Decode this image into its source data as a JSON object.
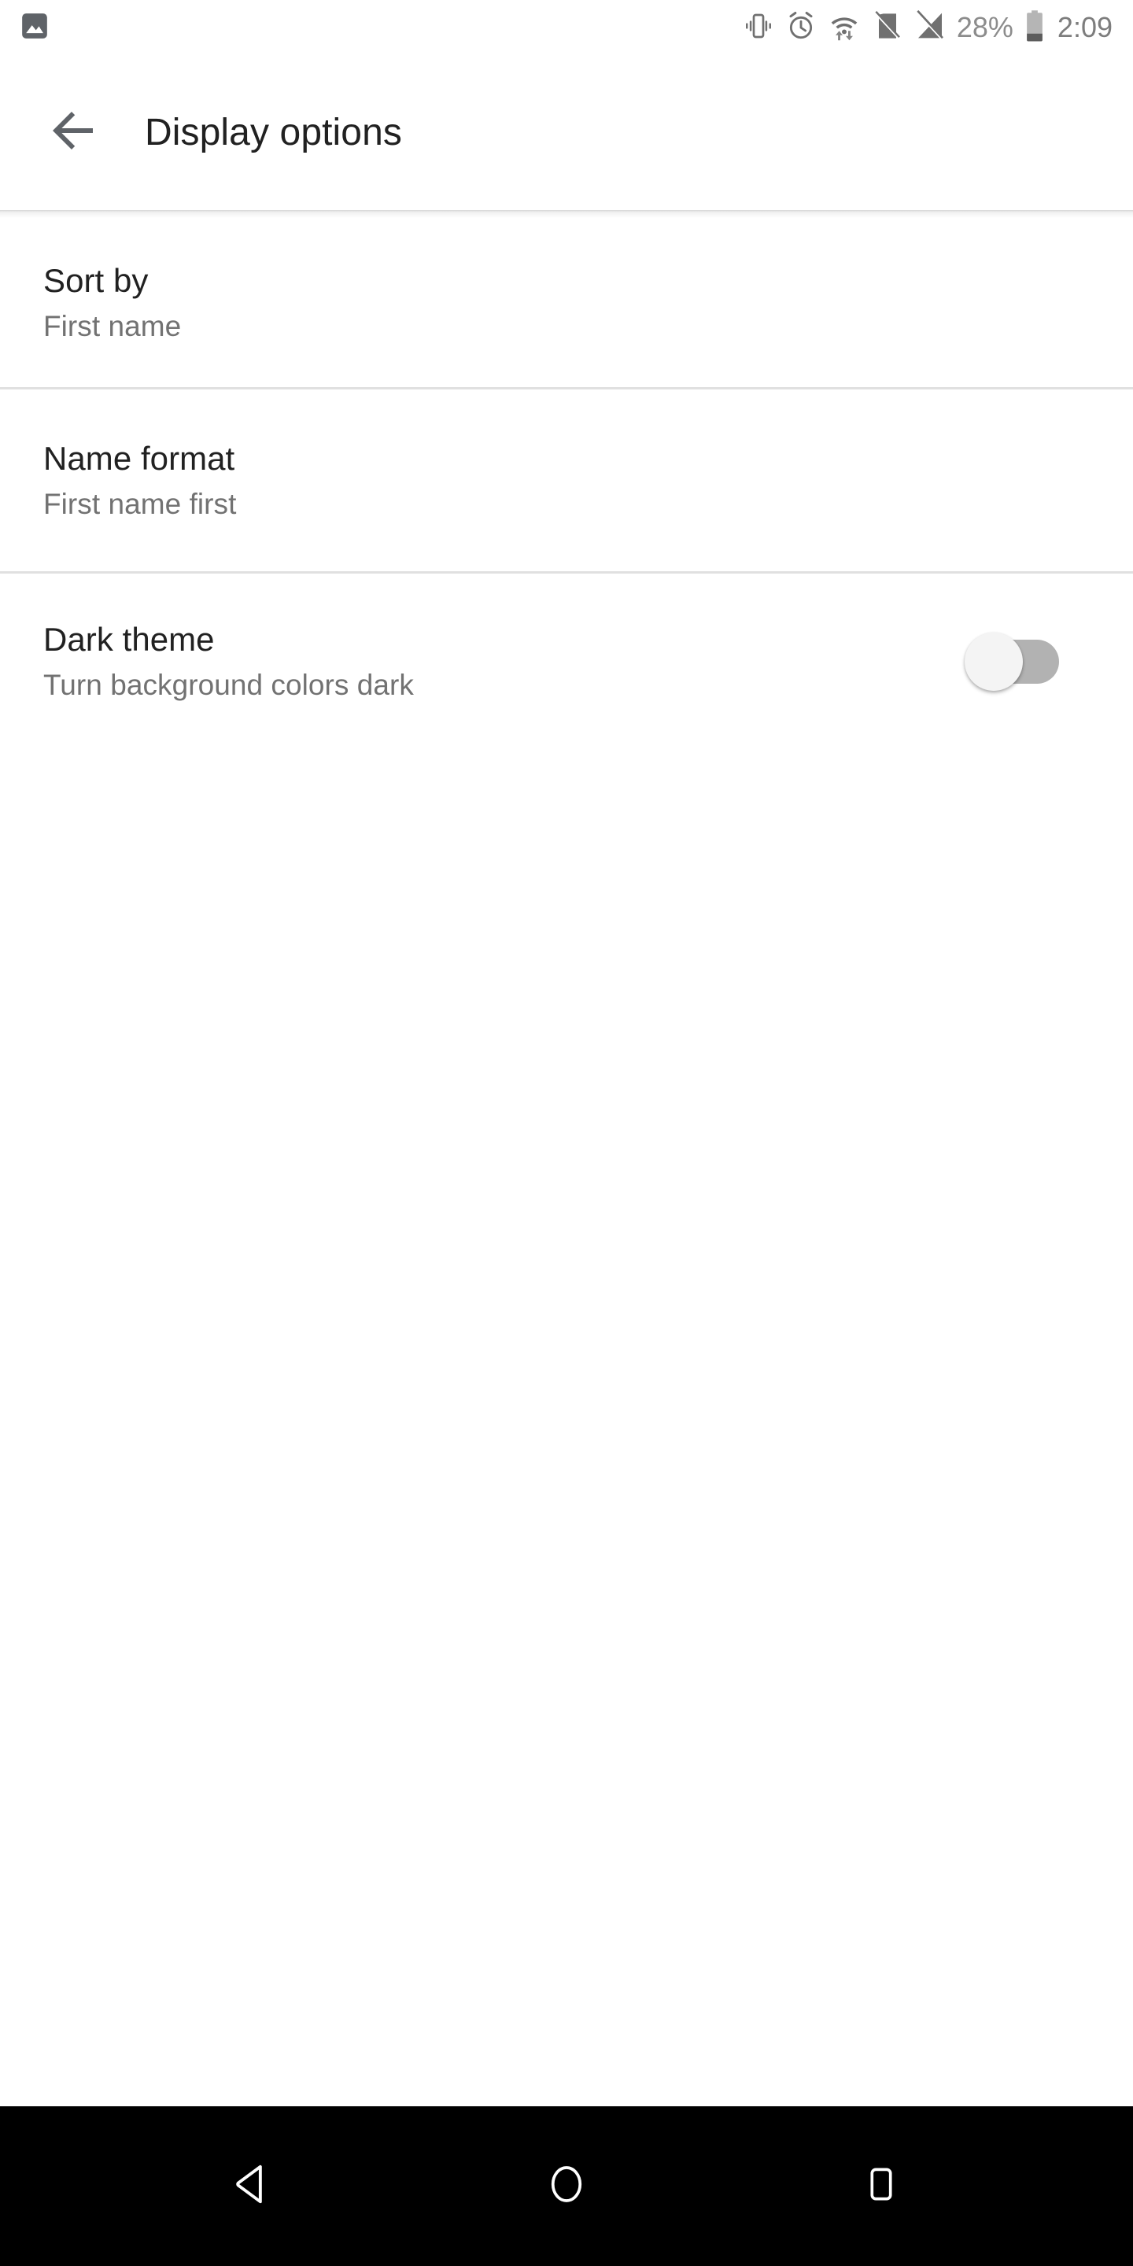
{
  "status_bar": {
    "notification_icon": "image-notification-icon",
    "icons": [
      "vibrate-icon",
      "alarm-icon",
      "wifi-data-transfer-icon",
      "no-sim-icon",
      "no-signal-icon"
    ],
    "battery_percent": "28%",
    "battery_icon": "battery-icon",
    "time": "2:09"
  },
  "app_bar": {
    "back_icon": "back-arrow-icon",
    "title": "Display options"
  },
  "preferences": [
    {
      "title": "Sort by",
      "summary": "First name",
      "type": "menu"
    },
    {
      "title": "Name format",
      "summary": "First name first",
      "type": "menu"
    },
    {
      "title": "Dark theme",
      "summary": "Turn background colors dark",
      "type": "switch",
      "switch_state": "off"
    }
  ],
  "nav_bar": {
    "back": "nav-back-icon",
    "home": "nav-home-icon",
    "recents": "nav-recents-icon"
  },
  "colors": {
    "background": "#ffffff",
    "title_text": "#212121",
    "summary_text": "#727272",
    "status_text": "#8c8c8c",
    "divider": "#e0e0e0",
    "switch_track_off": "#b2b2b2",
    "switch_thumb_off": "#f4f4f4",
    "nav_bar_bg": "#000000"
  }
}
